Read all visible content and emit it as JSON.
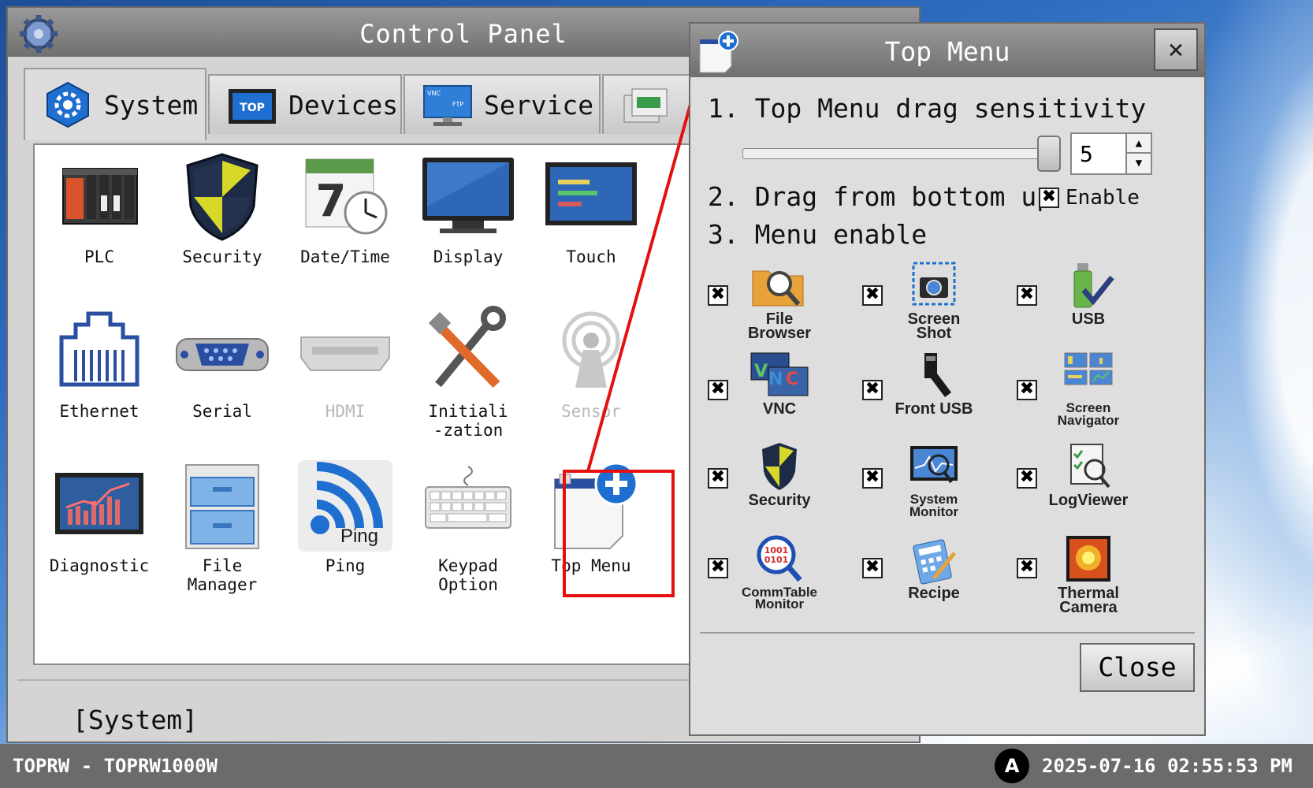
{
  "control_panel": {
    "title": "Control Panel",
    "tabs": [
      {
        "label": "System",
        "icon": "gear-hex-icon",
        "active": true
      },
      {
        "label": "Devices",
        "icon": "top-monitor-icon"
      },
      {
        "label": "Service",
        "icon": "vnc-ftp-icon"
      }
    ],
    "items": [
      {
        "label": "PLC",
        "icon": "plc-icon"
      },
      {
        "label": "Security",
        "icon": "shield-icon"
      },
      {
        "label": "Date/Time",
        "icon": "calendar-clock-icon"
      },
      {
        "label": "Display",
        "icon": "monitor-icon"
      },
      {
        "label": "Touch",
        "icon": "touch-icon"
      },
      {
        "label": "Ethernet",
        "icon": "ethernet-icon"
      },
      {
        "label": "Serial",
        "icon": "serial-port-icon"
      },
      {
        "label": "HDMI",
        "icon": "hdmi-icon",
        "disabled": true
      },
      {
        "label": "Initiali\n-zation",
        "icon": "tools-icon"
      },
      {
        "label": "Sensor",
        "icon": "sensor-icon",
        "disabled": true
      },
      {
        "label": "Diagnostic",
        "icon": "diagnostic-icon"
      },
      {
        "label": "File\nManager",
        "icon": "file-manager-icon"
      },
      {
        "label": "Ping",
        "icon": "ping-icon",
        "icon_text": "Ping"
      },
      {
        "label": "Keypad\nOption",
        "icon": "keyboard-icon"
      },
      {
        "label": "Top Menu",
        "icon": "top-menu-icon",
        "highlighted": true
      }
    ],
    "status_label": "[System]"
  },
  "top_menu": {
    "title": "Top Menu",
    "close_x": "×",
    "row1": "1. Top Menu drag sensitivity",
    "sensitivity": 5,
    "sensitivity_max": 5,
    "row2": "2. Drag from bottom up",
    "enable_label": "Enable",
    "enable_checked": true,
    "row3": "3. Menu enable",
    "menu_items": [
      {
        "label": "File\nBrowser",
        "icon": "file-browser-icon",
        "checked": true
      },
      {
        "label": "Screen\nShot",
        "icon": "screenshot-icon",
        "checked": true
      },
      {
        "label": "USB",
        "icon": "usb-icon",
        "checked": true
      },
      {
        "label": "VNC",
        "icon": "vnc-icon",
        "checked": true
      },
      {
        "label": "Front USB",
        "icon": "front-usb-icon",
        "checked": true
      },
      {
        "label": "Screen\nNavigator",
        "icon": "screen-navigator-icon",
        "checked": true
      },
      {
        "label": "Security",
        "icon": "shield-icon",
        "checked": true
      },
      {
        "label": "System\nMonitor",
        "icon": "system-monitor-icon",
        "checked": true
      },
      {
        "label": "LogViewer",
        "icon": "logviewer-icon",
        "checked": true
      },
      {
        "label": "CommTable\nMonitor",
        "icon": "commtable-icon",
        "checked": true
      },
      {
        "label": "Recipe",
        "icon": "recipe-icon",
        "checked": true
      },
      {
        "label": "Thermal\nCamera",
        "icon": "thermal-camera-icon",
        "checked": true
      }
    ],
    "check_mark": "✖",
    "close_label": "Close"
  },
  "taskbar": {
    "left_text": "TOPRW - TOPRW1000W",
    "badge": "A",
    "clock": "2025-07-16 02:55:53 PM"
  },
  "colors": {
    "highlight": "#e41010",
    "titlebar": "#7a7a7a",
    "accent_blue": "#1f6fd0"
  }
}
